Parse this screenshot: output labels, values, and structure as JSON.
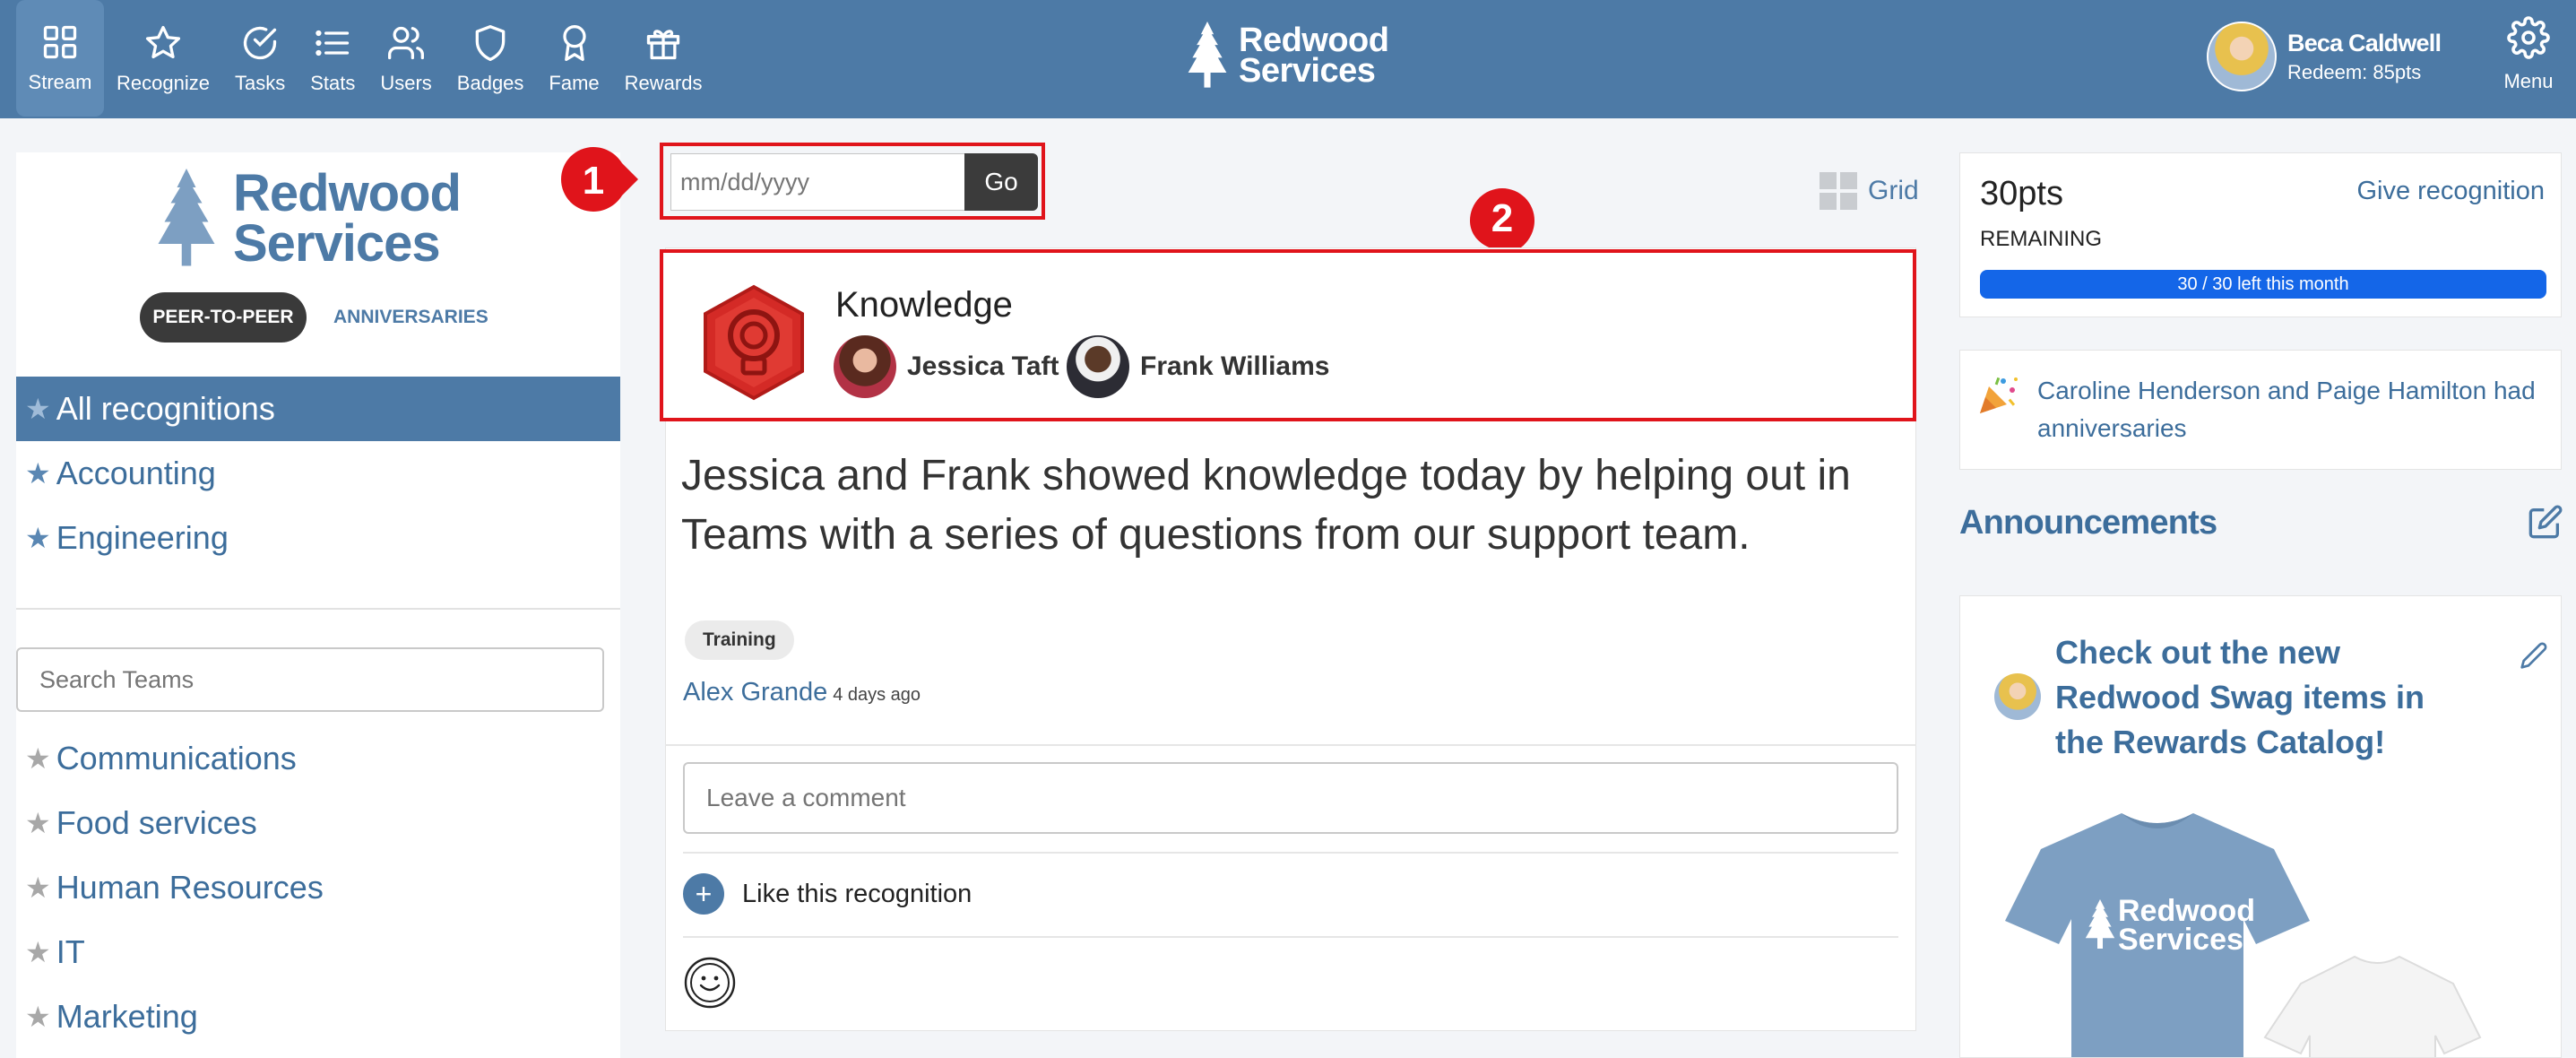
{
  "nav": {
    "items": [
      {
        "label": "Stream",
        "icon": "grid-icon"
      },
      {
        "label": "Recognize",
        "icon": "star-icon"
      },
      {
        "label": "Tasks",
        "icon": "check-circle-icon"
      },
      {
        "label": "Stats",
        "icon": "list-icon"
      },
      {
        "label": "Users",
        "icon": "users-icon"
      },
      {
        "label": "Badges",
        "icon": "shield-icon"
      },
      {
        "label": "Fame",
        "icon": "award-icon"
      },
      {
        "label": "Rewards",
        "icon": "gift-icon"
      }
    ],
    "active": "Stream"
  },
  "brand": {
    "line1": "Redwood",
    "line2": "Services"
  },
  "user": {
    "name": "Beca Caldwell",
    "redeem": "Redeem: 85pts"
  },
  "menu_label": "Menu",
  "left": {
    "tabs": {
      "peer": "PEER-TO-PEER",
      "anniversaries": "ANNIVERSARIES"
    },
    "filters": [
      {
        "label": "All recognitions",
        "active": true
      },
      {
        "label": "Accounting",
        "active": false
      },
      {
        "label": "Engineering",
        "active": false
      }
    ],
    "search_placeholder": "Search Teams",
    "teams": [
      "Communications",
      "Food services",
      "Human Resources",
      "IT",
      "Marketing"
    ]
  },
  "date_filter": {
    "placeholder": "mm/dd/yyyy",
    "go_label": "Go"
  },
  "markers": [
    "1",
    "2"
  ],
  "grid_label": "Grid",
  "recognition": {
    "badge": "Knowledge",
    "recipients": [
      "Jessica Taft",
      "Frank Williams"
    ],
    "message": "Jessica and Frank showed knowledge today by helping out in Teams with a series of questions from our support team.",
    "tag": "Training",
    "author": "Alex Grande",
    "time_ago": "4 days ago",
    "comment_placeholder": "Leave a comment",
    "like_label": "Like this recognition"
  },
  "points": {
    "amount": "30pts",
    "remaining_label": "REMAINING",
    "give_label": "Give recognition",
    "progress_label": "30 / 30 left this month",
    "progress_fraction": 1.0
  },
  "anniversary_note": "Caroline Henderson and Paige Hamilton had anniversaries",
  "announcements": {
    "title": "Announcements",
    "post_title": "Check out the new Redwood Swag items in the Rewards Catalog!"
  },
  "colors": {
    "brand": "#4d7aa6",
    "highlight": "#e0141b",
    "progress": "#1466e8"
  }
}
